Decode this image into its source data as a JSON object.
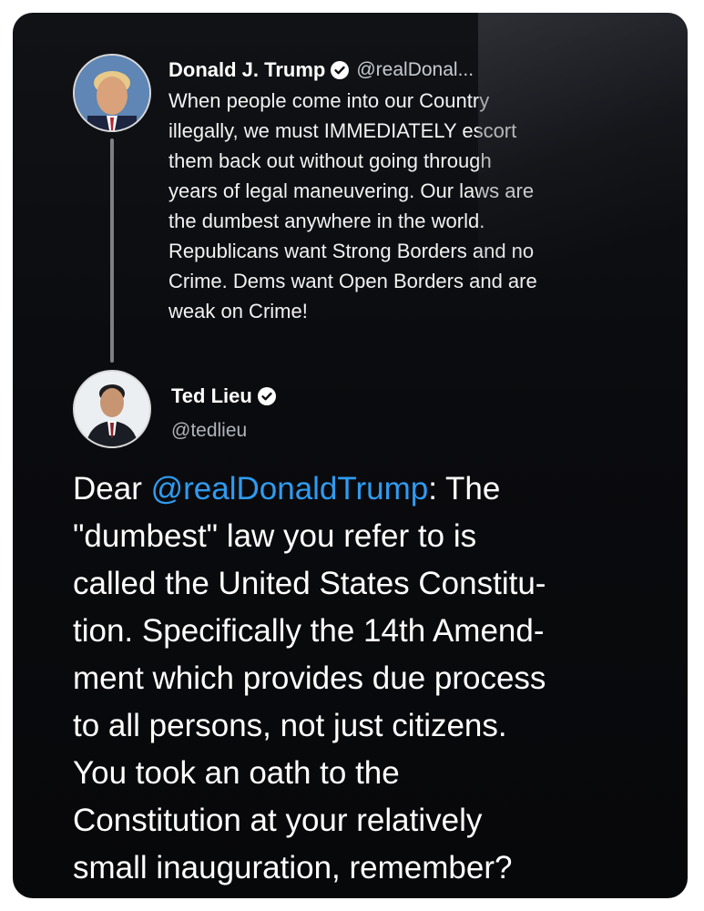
{
  "parent_tweet": {
    "author_name": "Donald J. Trump",
    "handle": "@realDonal...",
    "avatar_icon": "profile-photo",
    "body_lines": [
      "When people come into our Country",
      "illegally, we must IMMEDIATELY escort",
      "them back out without going through",
      "years of legal maneuvering. Our laws are",
      "the dumbest anywhere in the world.",
      "Republicans want Strong Borders and no",
      "Crime. Dems want Open Borders and are",
      "weak on Crime!"
    ]
  },
  "reply_tweet": {
    "author_name": "Ted Lieu",
    "handle": "@tedlieu",
    "avatar_icon": "profile-photo",
    "body": {
      "prefix": "Dear ",
      "mention": "@realDonaldTrump",
      "line1_suffix": ": The",
      "lines": [
        "\"dumbest\" law you refer to is",
        "called the United States Constitu-",
        "tion. Specifically the 14th Amend-",
        "ment which provides due process",
        "to all persons, not just citizens.",
        "You took an oath to the",
        "Constitution at your relatively",
        "small inauguration, remember?"
      ]
    }
  },
  "colors": {
    "background": "#0b0c0f",
    "text": "#ffffff",
    "link": "#2f9bf0",
    "verified_badge": "#ffffff"
  }
}
